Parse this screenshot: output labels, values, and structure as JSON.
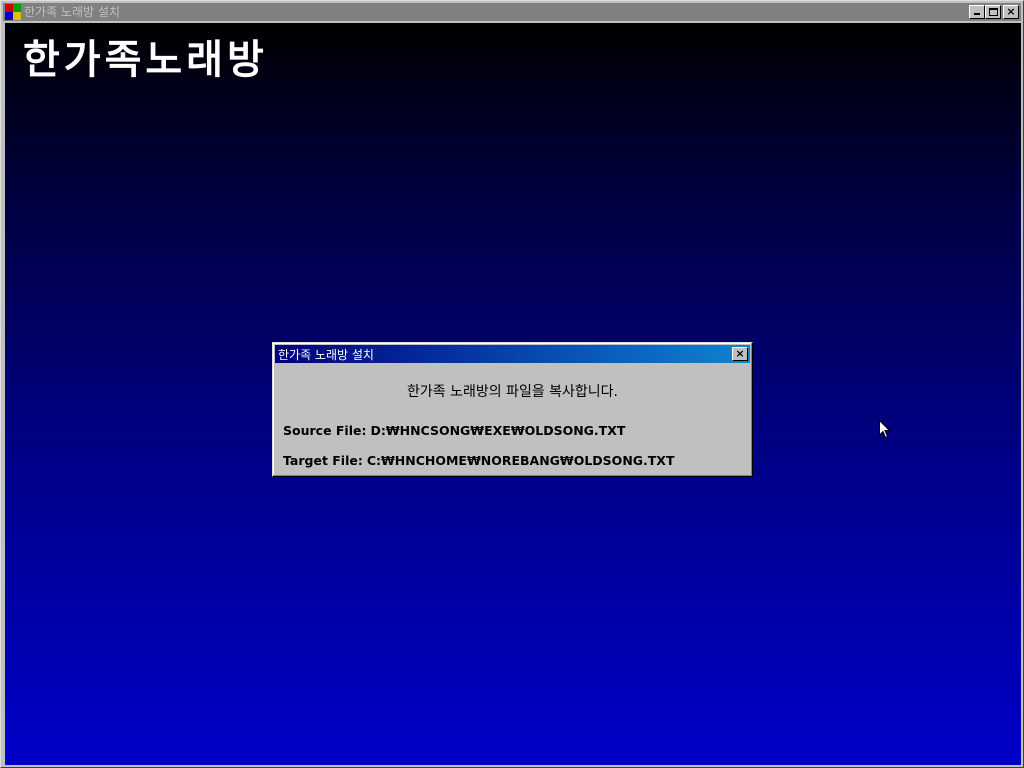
{
  "app": {
    "title": "한가족 노래방 설치",
    "logo_text": "한가족노래방",
    "icon": "setup-app-icon"
  },
  "window_controls": {
    "minimize_icon": "minimize-icon",
    "maximize_icon": "maximize-icon",
    "close_icon": "close-icon",
    "close_glyph": "×"
  },
  "dialog": {
    "title": "한가족 노래방 설치",
    "message": "한가족 노래방의 파일을 복사합니다.",
    "source_label": "Source File:",
    "source_path": "D:₩HNCSONG₩EXE₩OLDSONG.TXT",
    "target_label": "Target File:",
    "target_path": "C:₩HNCHOME₩NOREBANG₩OLDSONG.TXT",
    "close_glyph": "×"
  },
  "colors": {
    "dialog_title_start": "#000080",
    "dialog_title_end": "#1084d0",
    "background_top": "#000000",
    "background_bottom": "#0000c8"
  }
}
